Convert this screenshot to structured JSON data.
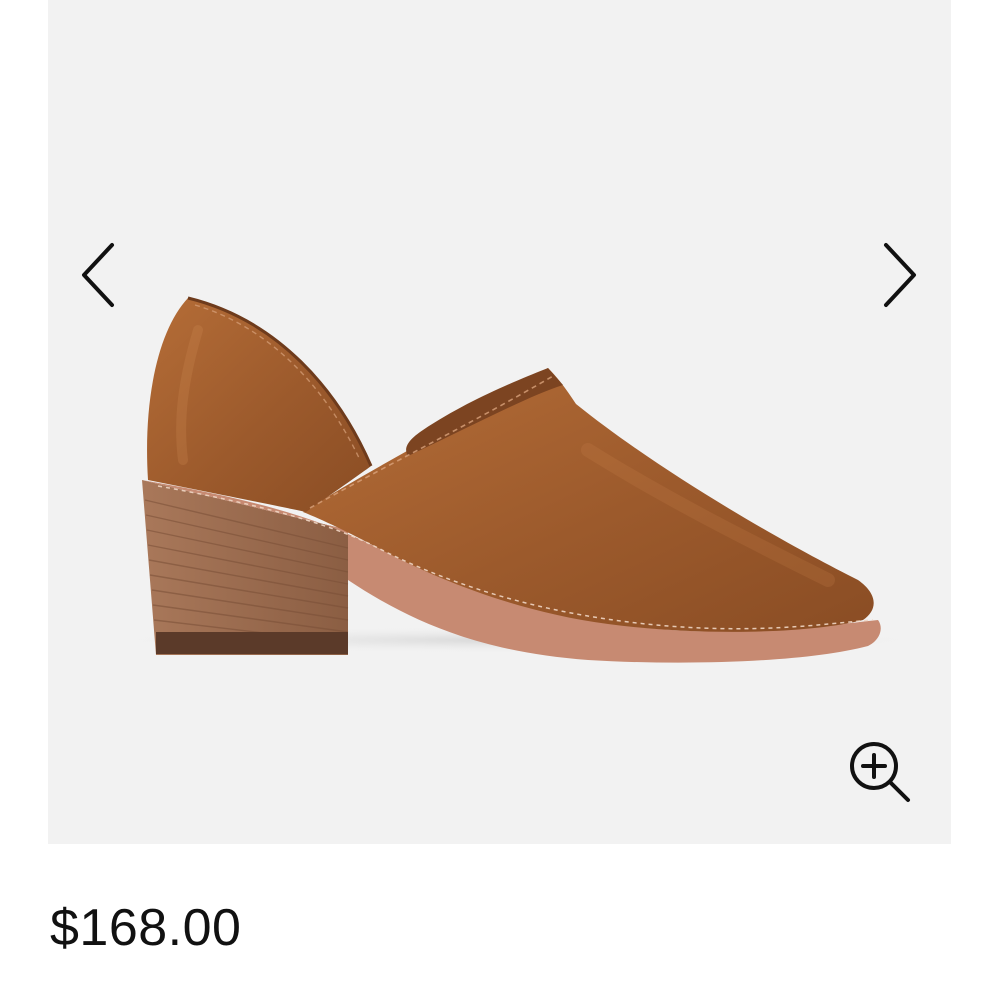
{
  "product": {
    "price": "$168.00",
    "image_subject": "shoe-image",
    "colors": {
      "gallery_background": "#f2f2f2",
      "leather": "#a45f2f",
      "heel": "#9a6a4c",
      "sole": "#c98a73",
      "icon": "#111111"
    }
  },
  "gallery": {
    "prev_icon": "chevron-left-icon",
    "next_icon": "chevron-right-icon",
    "zoom_icon": "zoom-in-icon"
  }
}
